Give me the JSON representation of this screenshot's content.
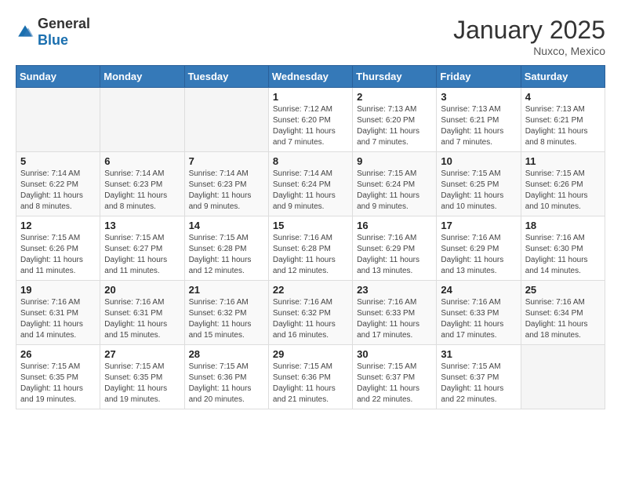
{
  "header": {
    "logo_general": "General",
    "logo_blue": "Blue",
    "month_year": "January 2025",
    "location": "Nuxco, Mexico"
  },
  "weekdays": [
    "Sunday",
    "Monday",
    "Tuesday",
    "Wednesday",
    "Thursday",
    "Friday",
    "Saturday"
  ],
  "weeks": [
    [
      {
        "day": "",
        "sunrise": "",
        "sunset": "",
        "daylight": ""
      },
      {
        "day": "",
        "sunrise": "",
        "sunset": "",
        "daylight": ""
      },
      {
        "day": "",
        "sunrise": "",
        "sunset": "",
        "daylight": ""
      },
      {
        "day": "1",
        "sunrise": "Sunrise: 7:12 AM",
        "sunset": "Sunset: 6:20 PM",
        "daylight": "Daylight: 11 hours and 7 minutes."
      },
      {
        "day": "2",
        "sunrise": "Sunrise: 7:13 AM",
        "sunset": "Sunset: 6:20 PM",
        "daylight": "Daylight: 11 hours and 7 minutes."
      },
      {
        "day": "3",
        "sunrise": "Sunrise: 7:13 AM",
        "sunset": "Sunset: 6:21 PM",
        "daylight": "Daylight: 11 hours and 7 minutes."
      },
      {
        "day": "4",
        "sunrise": "Sunrise: 7:13 AM",
        "sunset": "Sunset: 6:21 PM",
        "daylight": "Daylight: 11 hours and 8 minutes."
      }
    ],
    [
      {
        "day": "5",
        "sunrise": "Sunrise: 7:14 AM",
        "sunset": "Sunset: 6:22 PM",
        "daylight": "Daylight: 11 hours and 8 minutes."
      },
      {
        "day": "6",
        "sunrise": "Sunrise: 7:14 AM",
        "sunset": "Sunset: 6:23 PM",
        "daylight": "Daylight: 11 hours and 8 minutes."
      },
      {
        "day": "7",
        "sunrise": "Sunrise: 7:14 AM",
        "sunset": "Sunset: 6:23 PM",
        "daylight": "Daylight: 11 hours and 9 minutes."
      },
      {
        "day": "8",
        "sunrise": "Sunrise: 7:14 AM",
        "sunset": "Sunset: 6:24 PM",
        "daylight": "Daylight: 11 hours and 9 minutes."
      },
      {
        "day": "9",
        "sunrise": "Sunrise: 7:15 AM",
        "sunset": "Sunset: 6:24 PM",
        "daylight": "Daylight: 11 hours and 9 minutes."
      },
      {
        "day": "10",
        "sunrise": "Sunrise: 7:15 AM",
        "sunset": "Sunset: 6:25 PM",
        "daylight": "Daylight: 11 hours and 10 minutes."
      },
      {
        "day": "11",
        "sunrise": "Sunrise: 7:15 AM",
        "sunset": "Sunset: 6:26 PM",
        "daylight": "Daylight: 11 hours and 10 minutes."
      }
    ],
    [
      {
        "day": "12",
        "sunrise": "Sunrise: 7:15 AM",
        "sunset": "Sunset: 6:26 PM",
        "daylight": "Daylight: 11 hours and 11 minutes."
      },
      {
        "day": "13",
        "sunrise": "Sunrise: 7:15 AM",
        "sunset": "Sunset: 6:27 PM",
        "daylight": "Daylight: 11 hours and 11 minutes."
      },
      {
        "day": "14",
        "sunrise": "Sunrise: 7:15 AM",
        "sunset": "Sunset: 6:28 PM",
        "daylight": "Daylight: 11 hours and 12 minutes."
      },
      {
        "day": "15",
        "sunrise": "Sunrise: 7:16 AM",
        "sunset": "Sunset: 6:28 PM",
        "daylight": "Daylight: 11 hours and 12 minutes."
      },
      {
        "day": "16",
        "sunrise": "Sunrise: 7:16 AM",
        "sunset": "Sunset: 6:29 PM",
        "daylight": "Daylight: 11 hours and 13 minutes."
      },
      {
        "day": "17",
        "sunrise": "Sunrise: 7:16 AM",
        "sunset": "Sunset: 6:29 PM",
        "daylight": "Daylight: 11 hours and 13 minutes."
      },
      {
        "day": "18",
        "sunrise": "Sunrise: 7:16 AM",
        "sunset": "Sunset: 6:30 PM",
        "daylight": "Daylight: 11 hours and 14 minutes."
      }
    ],
    [
      {
        "day": "19",
        "sunrise": "Sunrise: 7:16 AM",
        "sunset": "Sunset: 6:31 PM",
        "daylight": "Daylight: 11 hours and 14 minutes."
      },
      {
        "day": "20",
        "sunrise": "Sunrise: 7:16 AM",
        "sunset": "Sunset: 6:31 PM",
        "daylight": "Daylight: 11 hours and 15 minutes."
      },
      {
        "day": "21",
        "sunrise": "Sunrise: 7:16 AM",
        "sunset": "Sunset: 6:32 PM",
        "daylight": "Daylight: 11 hours and 15 minutes."
      },
      {
        "day": "22",
        "sunrise": "Sunrise: 7:16 AM",
        "sunset": "Sunset: 6:32 PM",
        "daylight": "Daylight: 11 hours and 16 minutes."
      },
      {
        "day": "23",
        "sunrise": "Sunrise: 7:16 AM",
        "sunset": "Sunset: 6:33 PM",
        "daylight": "Daylight: 11 hours and 17 minutes."
      },
      {
        "day": "24",
        "sunrise": "Sunrise: 7:16 AM",
        "sunset": "Sunset: 6:33 PM",
        "daylight": "Daylight: 11 hours and 17 minutes."
      },
      {
        "day": "25",
        "sunrise": "Sunrise: 7:16 AM",
        "sunset": "Sunset: 6:34 PM",
        "daylight": "Daylight: 11 hours and 18 minutes."
      }
    ],
    [
      {
        "day": "26",
        "sunrise": "Sunrise: 7:15 AM",
        "sunset": "Sunset: 6:35 PM",
        "daylight": "Daylight: 11 hours and 19 minutes."
      },
      {
        "day": "27",
        "sunrise": "Sunrise: 7:15 AM",
        "sunset": "Sunset: 6:35 PM",
        "daylight": "Daylight: 11 hours and 19 minutes."
      },
      {
        "day": "28",
        "sunrise": "Sunrise: 7:15 AM",
        "sunset": "Sunset: 6:36 PM",
        "daylight": "Daylight: 11 hours and 20 minutes."
      },
      {
        "day": "29",
        "sunrise": "Sunrise: 7:15 AM",
        "sunset": "Sunset: 6:36 PM",
        "daylight": "Daylight: 11 hours and 21 minutes."
      },
      {
        "day": "30",
        "sunrise": "Sunrise: 7:15 AM",
        "sunset": "Sunset: 6:37 PM",
        "daylight": "Daylight: 11 hours and 22 minutes."
      },
      {
        "day": "31",
        "sunrise": "Sunrise: 7:15 AM",
        "sunset": "Sunset: 6:37 PM",
        "daylight": "Daylight: 11 hours and 22 minutes."
      },
      {
        "day": "",
        "sunrise": "",
        "sunset": "",
        "daylight": ""
      }
    ]
  ]
}
